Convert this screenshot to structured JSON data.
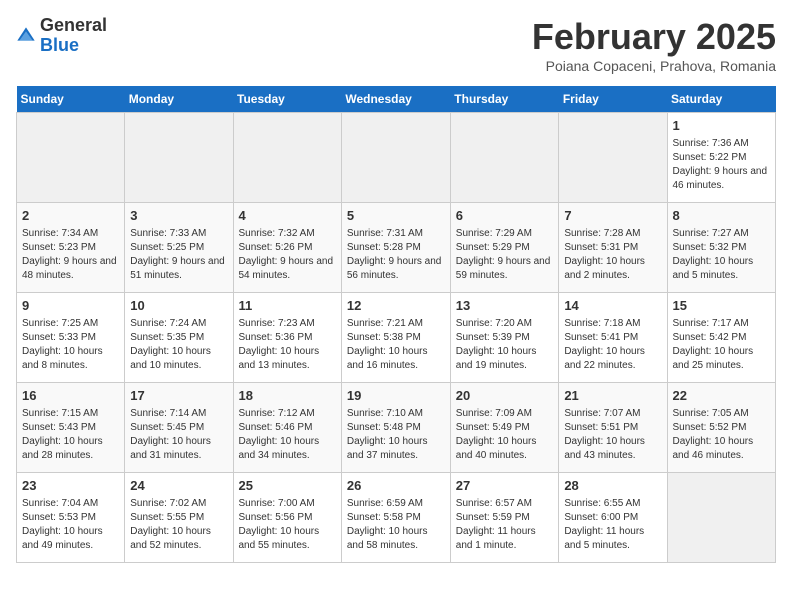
{
  "header": {
    "logo_general": "General",
    "logo_blue": "Blue",
    "title": "February 2025",
    "subtitle": "Poiana Copaceni, Prahova, Romania"
  },
  "days_of_week": [
    "Sunday",
    "Monday",
    "Tuesday",
    "Wednesday",
    "Thursday",
    "Friday",
    "Saturday"
  ],
  "weeks": [
    [
      {
        "day": "",
        "info": ""
      },
      {
        "day": "",
        "info": ""
      },
      {
        "day": "",
        "info": ""
      },
      {
        "day": "",
        "info": ""
      },
      {
        "day": "",
        "info": ""
      },
      {
        "day": "",
        "info": ""
      },
      {
        "day": "1",
        "info": "Sunrise: 7:36 AM\nSunset: 5:22 PM\nDaylight: 9 hours and 46 minutes."
      }
    ],
    [
      {
        "day": "2",
        "info": "Sunrise: 7:34 AM\nSunset: 5:23 PM\nDaylight: 9 hours and 48 minutes."
      },
      {
        "day": "3",
        "info": "Sunrise: 7:33 AM\nSunset: 5:25 PM\nDaylight: 9 hours and 51 minutes."
      },
      {
        "day": "4",
        "info": "Sunrise: 7:32 AM\nSunset: 5:26 PM\nDaylight: 9 hours and 54 minutes."
      },
      {
        "day": "5",
        "info": "Sunrise: 7:31 AM\nSunset: 5:28 PM\nDaylight: 9 hours and 56 minutes."
      },
      {
        "day": "6",
        "info": "Sunrise: 7:29 AM\nSunset: 5:29 PM\nDaylight: 9 hours and 59 minutes."
      },
      {
        "day": "7",
        "info": "Sunrise: 7:28 AM\nSunset: 5:31 PM\nDaylight: 10 hours and 2 minutes."
      },
      {
        "day": "8",
        "info": "Sunrise: 7:27 AM\nSunset: 5:32 PM\nDaylight: 10 hours and 5 minutes."
      }
    ],
    [
      {
        "day": "9",
        "info": "Sunrise: 7:25 AM\nSunset: 5:33 PM\nDaylight: 10 hours and 8 minutes."
      },
      {
        "day": "10",
        "info": "Sunrise: 7:24 AM\nSunset: 5:35 PM\nDaylight: 10 hours and 10 minutes."
      },
      {
        "day": "11",
        "info": "Sunrise: 7:23 AM\nSunset: 5:36 PM\nDaylight: 10 hours and 13 minutes."
      },
      {
        "day": "12",
        "info": "Sunrise: 7:21 AM\nSunset: 5:38 PM\nDaylight: 10 hours and 16 minutes."
      },
      {
        "day": "13",
        "info": "Sunrise: 7:20 AM\nSunset: 5:39 PM\nDaylight: 10 hours and 19 minutes."
      },
      {
        "day": "14",
        "info": "Sunrise: 7:18 AM\nSunset: 5:41 PM\nDaylight: 10 hours and 22 minutes."
      },
      {
        "day": "15",
        "info": "Sunrise: 7:17 AM\nSunset: 5:42 PM\nDaylight: 10 hours and 25 minutes."
      }
    ],
    [
      {
        "day": "16",
        "info": "Sunrise: 7:15 AM\nSunset: 5:43 PM\nDaylight: 10 hours and 28 minutes."
      },
      {
        "day": "17",
        "info": "Sunrise: 7:14 AM\nSunset: 5:45 PM\nDaylight: 10 hours and 31 minutes."
      },
      {
        "day": "18",
        "info": "Sunrise: 7:12 AM\nSunset: 5:46 PM\nDaylight: 10 hours and 34 minutes."
      },
      {
        "day": "19",
        "info": "Sunrise: 7:10 AM\nSunset: 5:48 PM\nDaylight: 10 hours and 37 minutes."
      },
      {
        "day": "20",
        "info": "Sunrise: 7:09 AM\nSunset: 5:49 PM\nDaylight: 10 hours and 40 minutes."
      },
      {
        "day": "21",
        "info": "Sunrise: 7:07 AM\nSunset: 5:51 PM\nDaylight: 10 hours and 43 minutes."
      },
      {
        "day": "22",
        "info": "Sunrise: 7:05 AM\nSunset: 5:52 PM\nDaylight: 10 hours and 46 minutes."
      }
    ],
    [
      {
        "day": "23",
        "info": "Sunrise: 7:04 AM\nSunset: 5:53 PM\nDaylight: 10 hours and 49 minutes."
      },
      {
        "day": "24",
        "info": "Sunrise: 7:02 AM\nSunset: 5:55 PM\nDaylight: 10 hours and 52 minutes."
      },
      {
        "day": "25",
        "info": "Sunrise: 7:00 AM\nSunset: 5:56 PM\nDaylight: 10 hours and 55 minutes."
      },
      {
        "day": "26",
        "info": "Sunrise: 6:59 AM\nSunset: 5:58 PM\nDaylight: 10 hours and 58 minutes."
      },
      {
        "day": "27",
        "info": "Sunrise: 6:57 AM\nSunset: 5:59 PM\nDaylight: 11 hours and 1 minute."
      },
      {
        "day": "28",
        "info": "Sunrise: 6:55 AM\nSunset: 6:00 PM\nDaylight: 11 hours and 5 minutes."
      },
      {
        "day": "",
        "info": ""
      }
    ]
  ]
}
